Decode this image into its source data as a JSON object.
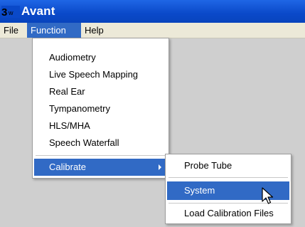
{
  "window": {
    "title": "Avant",
    "icon": "avant-app-icon",
    "colors": {
      "titlebar": "#0a49c9",
      "highlight": "#316ac5",
      "menubar": "#ece9d8",
      "workarea": "#cfcfcf"
    }
  },
  "menubar": {
    "items": [
      {
        "label": "File",
        "active": false
      },
      {
        "label": "Function",
        "active": true
      },
      {
        "label": "Help",
        "active": false
      }
    ]
  },
  "function_menu": {
    "items": [
      {
        "label": "Audiometry"
      },
      {
        "label": "Live Speech Mapping"
      },
      {
        "label": "Real Ear"
      },
      {
        "label": "Tympanometry"
      },
      {
        "label": "HLS/MHA"
      },
      {
        "label": "Speech Waterfall"
      },
      {
        "label": "Calibrate",
        "highlighted": true,
        "has_submenu": true
      }
    ]
  },
  "calibrate_submenu": {
    "items": [
      {
        "label": "Probe Tube"
      },
      {
        "label": "System",
        "highlighted": true
      },
      {
        "label": "Load Calibration Files"
      }
    ]
  },
  "cursor": {
    "icon": "arrow-pointer-icon"
  }
}
